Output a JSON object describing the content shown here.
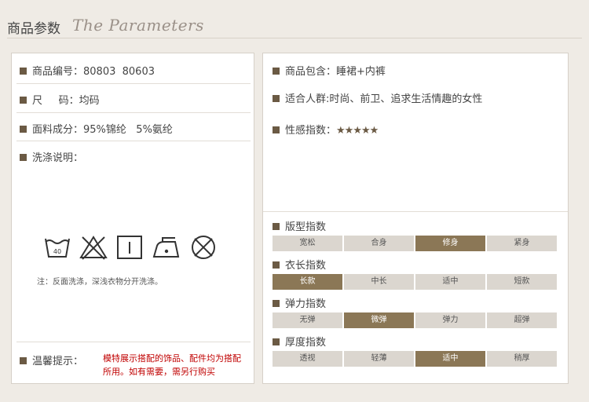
{
  "header": {
    "title_cn": "商品参数",
    "title_en": "The Parameters"
  },
  "left": {
    "item_no": {
      "label": "商品编号：",
      "value": "80803  80603"
    },
    "size": {
      "label": "尺     码：",
      "value": "均码"
    },
    "fabric": {
      "label": "面料成分：",
      "value": "95%锦纶   5%氨纶"
    },
    "wash": {
      "label": "洗涤说明："
    },
    "care_icons": [
      "wash-40-icon",
      "no-bleach-icon",
      "hang-dry-icon",
      "iron-low-icon",
      "no-dryclean-icon"
    ],
    "wash_temp": "40",
    "note": "注：反面洗涤，深浅衣物分开洗涤。",
    "tips": {
      "label": "温馨提示：",
      "text": "模特展示搭配的饰品、配件均为搭配所用。如有需要，需另行购买"
    }
  },
  "right": {
    "package": {
      "label": "商品包含：",
      "value": "睡裙+内裤"
    },
    "people": {
      "label": "适合人群:",
      "value": "时尚、前卫、追求生活情趣的女性"
    },
    "sexy": {
      "label": "性感指数：",
      "value": "★★★★★",
      "rating": 5
    },
    "indices": [
      {
        "title": "版型指数",
        "options": [
          "宽松",
          "合身",
          "修身",
          "紧身"
        ],
        "selected": 2
      },
      {
        "title": "衣长指数",
        "options": [
          "长款",
          "中长",
          "适中",
          "短款"
        ],
        "selected": 0
      },
      {
        "title": "弹力指数",
        "options": [
          "无弹",
          "微弹",
          "弹力",
          "超弹"
        ],
        "selected": 1
      },
      {
        "title": "厚度指数",
        "options": [
          "透视",
          "轻薄",
          "适中",
          "稍厚"
        ],
        "selected": 2
      }
    ]
  },
  "colors": {
    "accent": "#8b7756",
    "option_bg": "#dbd6cf",
    "tip_red": "#c00000"
  }
}
